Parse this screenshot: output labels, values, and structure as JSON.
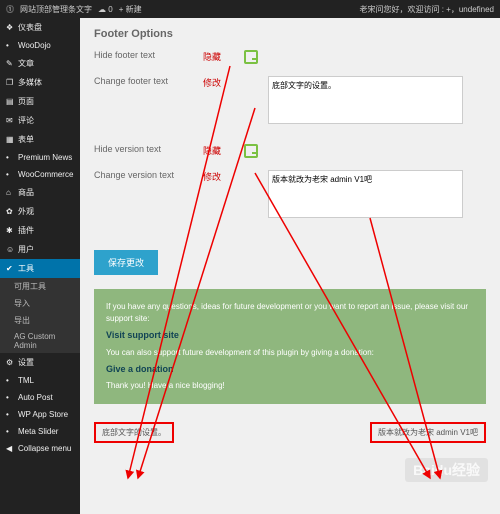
{
  "topbar": {
    "site": "网站顶部管理条文字",
    "comments": "0",
    "add": "+ 新建",
    "greeting": "老宋问您好，欢迎访问 : +，undefined"
  },
  "sidebar": {
    "items": [
      {
        "icon": "❖",
        "label": "仪表盘"
      },
      {
        "icon": "",
        "label": "WooDojo"
      },
      {
        "icon": "✎",
        "label": "文章"
      },
      {
        "icon": "❐",
        "label": "多媒体"
      },
      {
        "icon": "▤",
        "label": "页面"
      },
      {
        "icon": "✉",
        "label": "评论"
      },
      {
        "icon": "▦",
        "label": "表单"
      },
      {
        "icon": "",
        "label": "Premium News"
      },
      {
        "icon": "",
        "label": "WooCommerce"
      },
      {
        "icon": "⌂",
        "label": "商品"
      },
      {
        "icon": "✿",
        "label": "外观"
      },
      {
        "icon": "✱",
        "label": "插件"
      },
      {
        "icon": "☺",
        "label": "用户"
      },
      {
        "icon": "✔",
        "label": "工具"
      }
    ],
    "subs": [
      "可用工具",
      "导入",
      "导出",
      "AG Custom Admin"
    ],
    "items2": [
      {
        "icon": "⚙",
        "label": "设置"
      },
      {
        "icon": "",
        "label": "TML"
      },
      {
        "icon": "",
        "label": "Auto Post"
      },
      {
        "icon": "",
        "label": "WP App Store"
      },
      {
        "icon": "",
        "label": "Meta Slider"
      },
      {
        "icon": "◀",
        "label": "Collapse menu"
      }
    ]
  },
  "footer_options": {
    "title": "Footer Options",
    "hide_footer": "Hide footer text",
    "hide_footer_tag": "隐藏",
    "change_footer": "Change footer text",
    "change_footer_tag": "修改",
    "footer_text_value": "底部文字的设置。",
    "hide_version": "Hide version text",
    "hide_version_tag": "隐藏",
    "change_version": "Change version text",
    "change_version_tag": "修改",
    "version_text_value": "版本就改为老宋 admin V1吧",
    "save": "保存更改"
  },
  "green": {
    "line1": "If you have any questions, ideas for future development or you want to report an issue, please visit our support site:",
    "link1": "Visit support site",
    "line2": "You can also support future development of this plugin by giving a donation:",
    "link2": "Give a donation",
    "line3": "Thank you! Have a nice blogging!"
  },
  "bottom": {
    "left": "底部文字的设置。",
    "right": "版本就改为老宋 admin V1吧"
  },
  "watermark": "Baidu经验"
}
